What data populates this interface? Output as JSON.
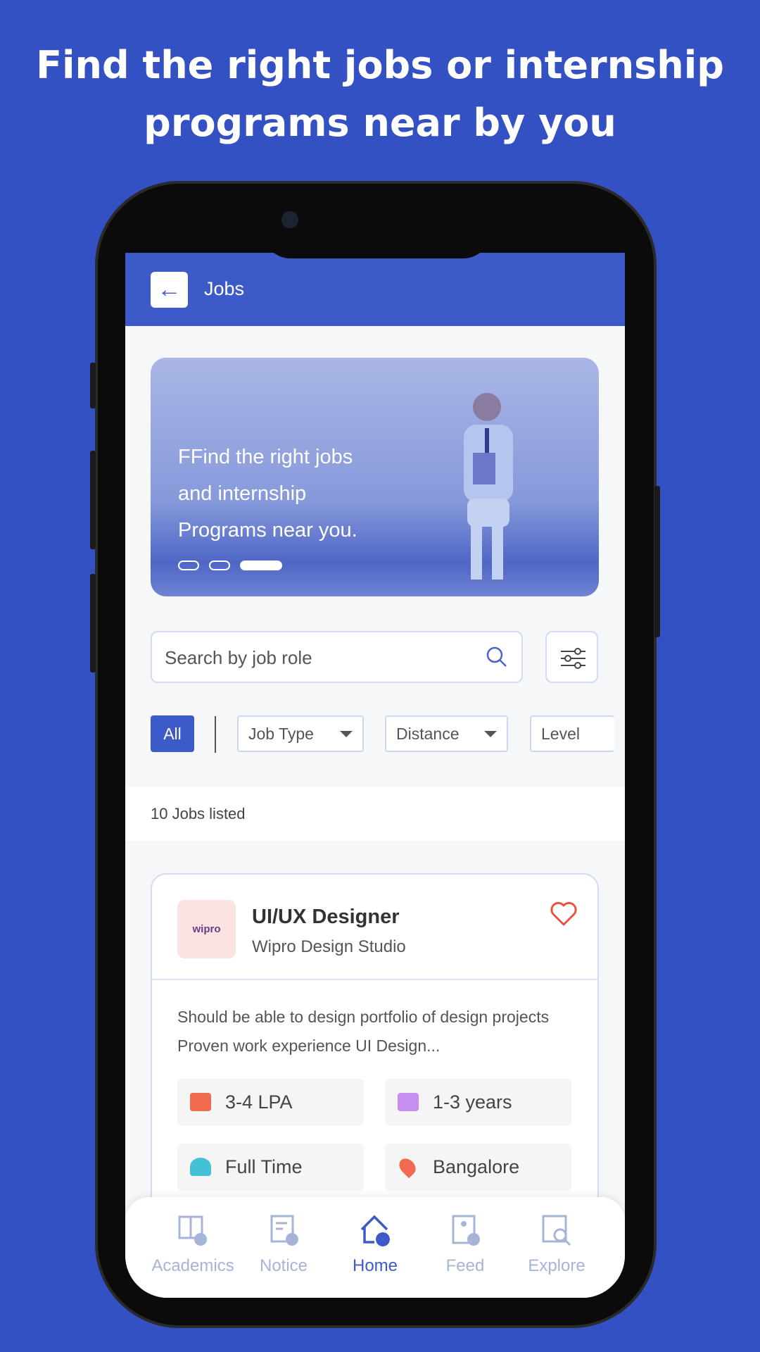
{
  "headline": {
    "line1": "Find the right jobs or internship",
    "line2": "programs near by you"
  },
  "header": {
    "title": "Jobs",
    "back_icon": "arrow-left-icon"
  },
  "banner": {
    "lines": [
      "FFind the right jobs",
      "and internship",
      "Programs near you."
    ],
    "active_slide": 3,
    "total_slides": 3
  },
  "search": {
    "placeholder": "Search by job role",
    "icon": "search-icon",
    "filter_icon": "sliders-icon"
  },
  "filters": {
    "all": "All",
    "chips": [
      "Job Type",
      "Distance",
      "Level"
    ]
  },
  "count": "10 Jobs listed",
  "job": {
    "title": "UI/UX Designer",
    "company": "Wipro Design Studio",
    "logo_text": "wipro",
    "description": "Should be able to design portfolio of design projects  Proven work experience UI Design...",
    "salary": "3-4 LPA",
    "experience": "1-3 years",
    "type": "Full Time",
    "location": "Bangalore",
    "favorite_color": "#e8533f"
  },
  "nav": {
    "items": [
      "Academics",
      "Notice",
      "Home",
      "Feed",
      "Explore"
    ],
    "active": "Home"
  },
  "colors": {
    "background": "#3451c3",
    "accent": "#3d5bc8"
  }
}
